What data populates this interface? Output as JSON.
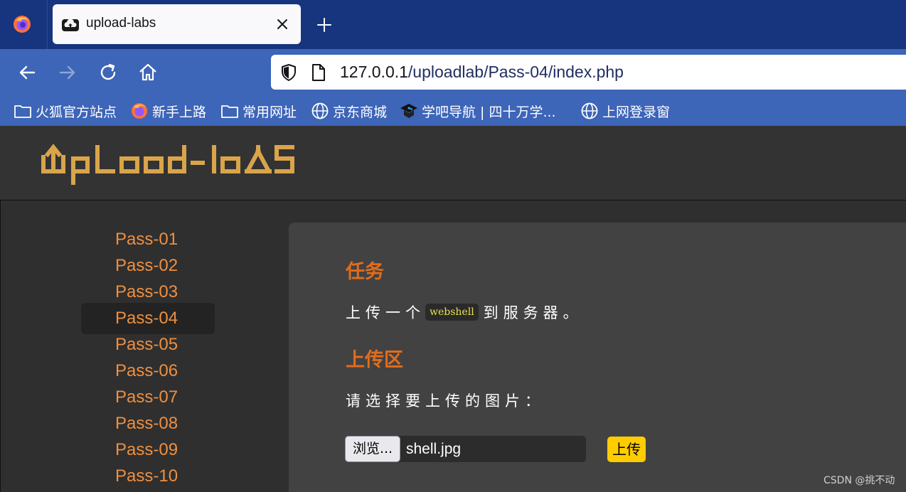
{
  "browser": {
    "tab_title": "upload-labs",
    "url_host": "127.0.0.1",
    "url_path": "/uploadlab/Pass-04/index.php",
    "bookmarks": [
      {
        "label": "火狐官方站点",
        "icon": "folder-icon"
      },
      {
        "label": "新手上路",
        "icon": "firefox-icon"
      },
      {
        "label": "常用网址",
        "icon": "folder-icon"
      },
      {
        "label": "京东商城",
        "icon": "globe-icon"
      },
      {
        "label": "学吧导航 | 四十万学...",
        "icon": "graduation-cap-icon"
      },
      {
        "label": "上网登录窗",
        "icon": "globe-icon"
      }
    ],
    "colors": {
      "tabbar": "#16357e",
      "toolbar": "#3d65b8"
    }
  },
  "page": {
    "logo_alt": "Upload-labs",
    "sidebar": {
      "items": [
        "Pass-01",
        "Pass-02",
        "Pass-03",
        "Pass-04",
        "Pass-05",
        "Pass-06",
        "Pass-07",
        "Pass-08",
        "Pass-09",
        "Pass-10"
      ],
      "active": "Pass-04"
    },
    "task": {
      "heading": "任务",
      "text_before": "上传一个",
      "code": "webshell",
      "text_after": "到服务器。"
    },
    "upload": {
      "heading": "上传区",
      "prompt": "请选择要上传的图片：",
      "browse_label": "浏览...",
      "file_name": "shell.jpg",
      "submit_label": "上传"
    },
    "colors": {
      "accent": "#e36c1b",
      "link": "#ef8f3f",
      "button": "#ffcc00",
      "code": "#e7e24a"
    },
    "watermark": "CSDN @挑不动"
  }
}
